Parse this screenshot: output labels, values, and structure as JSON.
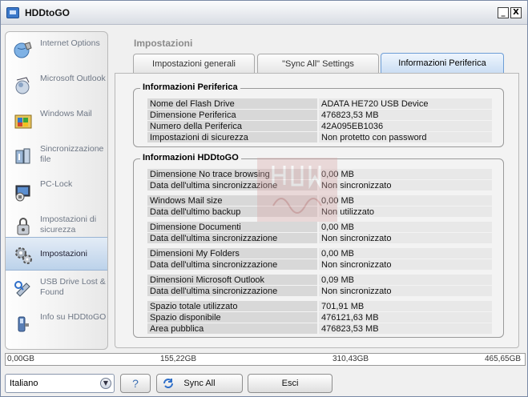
{
  "window": {
    "title": "HDDtoGO",
    "minimize_glyph": "_",
    "close_glyph": "X"
  },
  "sidebar": {
    "items": [
      {
        "label": "Internet Options",
        "icon": "internet-options-icon"
      },
      {
        "label": "Microsoft Outlook",
        "icon": "outlook-icon"
      },
      {
        "label": "Windows Mail",
        "icon": "windows-mail-icon"
      },
      {
        "label": "Sincronizzazione file",
        "icon": "sync-files-icon"
      },
      {
        "label": "PC-Lock",
        "icon": "pc-lock-icon"
      },
      {
        "label": "Impostazioni di sicurezza",
        "icon": "security-settings-icon"
      },
      {
        "label": "Impostazioni",
        "icon": "settings-icon",
        "selected": true
      },
      {
        "label": "USB Drive Lost & Found",
        "icon": "usb-lost-found-icon"
      },
      {
        "label": "Info su HDDtoGO",
        "icon": "info-icon"
      }
    ]
  },
  "main": {
    "section_title": "Impostazioni",
    "tabs": [
      {
        "label": "Impostazioni generali"
      },
      {
        "label": "\"Sync All\" Settings"
      },
      {
        "label": "Informazioni Periferica",
        "active": true
      }
    ]
  },
  "device_info": {
    "title": "Informazioni Periferica",
    "rows": [
      {
        "label": "Nome del Flash Drive",
        "value": "ADATA HE720 USB Device"
      },
      {
        "label": "Dimensione Periferica",
        "value": "476823,53 MB"
      },
      {
        "label": "Numero della Periferica",
        "value": "42A095EB1036"
      },
      {
        "label": "Impostazioni di sicurezza",
        "value": "Non protetto con password"
      }
    ]
  },
  "hddtogo_info": {
    "title": "Informazioni HDDtoGO",
    "rows": [
      {
        "label": "Dimensione No trace browsing",
        "value": "0,00 MB"
      },
      {
        "label": "Data dell'ultima sincronizzazione",
        "value": "Non sincronizzato"
      },
      {
        "label": "Windows Mail size",
        "value": "0,00 MB"
      },
      {
        "label": "Data dell'ultimo backup",
        "value": "Non utilizzato"
      },
      {
        "label": "Dimensione Documenti",
        "value": "0,00 MB"
      },
      {
        "label": "Data dell'ultima sincronizzazione",
        "value": "Non sincronizzato"
      },
      {
        "label": "Dimensioni My Folders",
        "value": "0,00 MB"
      },
      {
        "label": "Data dell'ultima sincronizzazione",
        "value": "Non sincronizzato"
      },
      {
        "label": "Dimensioni Microsoft Outlook",
        "value": "0,09 MB"
      },
      {
        "label": "Data dell'ultima sincronizzazione",
        "value": "Non sincronizzato"
      },
      {
        "label": "Spazio totale utilizzato",
        "value": "701,91 MB"
      },
      {
        "label": "Spazio disponibile",
        "value": "476121,63 MB"
      },
      {
        "label": "Area pubblica",
        "value": "476823,53 MB"
      }
    ]
  },
  "status_bar": {
    "labels": [
      "0,00GB",
      "155,22GB",
      "310,43GB",
      "465,65GB"
    ]
  },
  "footer": {
    "language": "Italiano",
    "help_glyph": "?",
    "sync_all_label": "Sync All",
    "exit_label": "Esci"
  },
  "colors": {
    "accent": "#3b78c9",
    "tab_active": "#c8dcf3",
    "selected_item": "#bcd2ea"
  }
}
